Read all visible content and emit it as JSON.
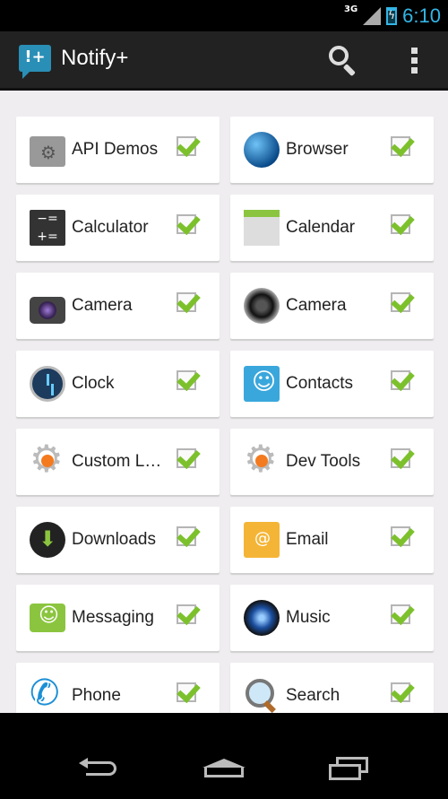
{
  "status_bar": {
    "network": "3G",
    "time": "6:10"
  },
  "action_bar": {
    "logo_text": "!+",
    "title": "Notify+"
  },
  "apps": [
    {
      "label": "API Demos",
      "icon": "folder-gear-icon",
      "checked": true
    },
    {
      "label": "Browser",
      "icon": "globe-icon",
      "checked": true
    },
    {
      "label": "Calculator",
      "icon": "calculator-icon",
      "checked": true
    },
    {
      "label": "Calendar",
      "icon": "calendar-icon",
      "checked": true
    },
    {
      "label": "Camera",
      "icon": "camera-icon",
      "checked": true
    },
    {
      "label": "Camera",
      "icon": "camera-lens-icon",
      "checked": true
    },
    {
      "label": "Clock",
      "icon": "clock-icon",
      "checked": true
    },
    {
      "label": "Contacts",
      "icon": "contacts-icon",
      "checked": true
    },
    {
      "label": "Custom L…",
      "icon": "gear-icon",
      "checked": true
    },
    {
      "label": "Dev Tools",
      "icon": "gear-icon",
      "checked": true
    },
    {
      "label": "Downloads",
      "icon": "download-icon",
      "checked": true
    },
    {
      "label": "Email",
      "icon": "email-icon",
      "checked": true
    },
    {
      "label": "Messaging",
      "icon": "messaging-icon",
      "checked": true
    },
    {
      "label": "Music",
      "icon": "music-icon",
      "checked": true
    },
    {
      "label": "Phone",
      "icon": "phone-icon",
      "checked": true
    },
    {
      "label": "Search",
      "icon": "search-icon",
      "checked": true
    }
  ],
  "colors": {
    "accent": "#33b5e5",
    "check": "#7cc12c",
    "background": "#efedef"
  }
}
